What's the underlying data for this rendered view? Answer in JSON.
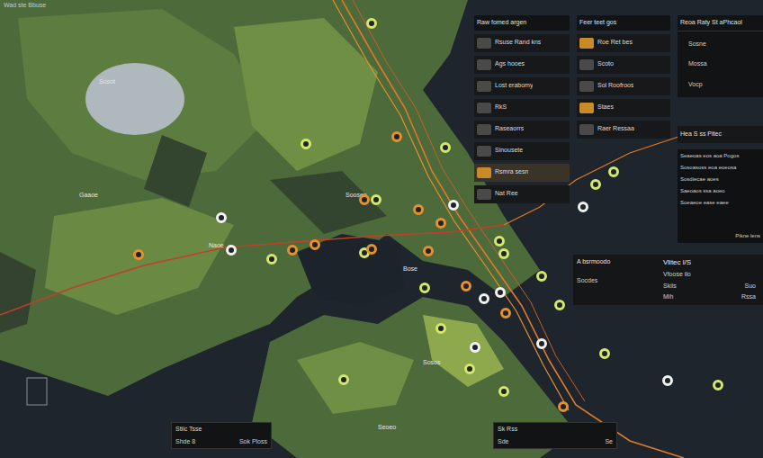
{
  "title": "Wad ste Bbuse",
  "layers": {
    "header": "Raw fomed argen",
    "rows": [
      {
        "label": "Rsuse Rand kns",
        "selected": false
      },
      {
        "label": "Ags hooes",
        "selected": false
      },
      {
        "label": "Lost erabomy",
        "selected": false
      },
      {
        "label": "RkS",
        "selected": false
      },
      {
        "label": "Raseaorrs",
        "selected": false
      },
      {
        "label": "Sinousete",
        "selected": false
      },
      {
        "label": "Rsmra sesn",
        "selected": true
      },
      {
        "label": "Nat Ree",
        "selected": false
      }
    ]
  },
  "filters": {
    "header": "Feer teet gos",
    "rows": [
      {
        "label": "Roe Ret bes",
        "selected": true
      },
      {
        "label": "Scoto",
        "selected": false
      },
      {
        "label": "Sol Roofroos",
        "selected": false
      },
      {
        "label": "Staes",
        "selected": true
      },
      {
        "label": "Raer Ressaa",
        "selected": false
      }
    ]
  },
  "details": {
    "header": "Reoa Raty St aPhcaol",
    "rows": [
      "Sosne",
      "Mossa",
      "Vocp"
    ]
  },
  "legend": {
    "header": "Hea S ss Pitec",
    "items": [
      "Seaeoas eos aoa Pogos",
      "Sosoasoss eoa eoeosa",
      "Sosdiecae aoes",
      "Saeoaos ssa aoeo",
      "Soeaeoe ease eaee"
    ],
    "footer": "Pikne lens"
  },
  "stats": {
    "title": "A bsrmoodo",
    "heading": "Vlitec l/S",
    "subheading": "Vfoose ilo",
    "label": "Socdes",
    "rows": [
      {
        "label": "Skiis",
        "value": "Suo"
      },
      {
        "label": "Mih",
        "value": "Rssa"
      }
    ]
  },
  "toolbars": [
    {
      "top": "Stiic Tsse",
      "bottom": [
        "Shde 8",
        "Sok Ploss"
      ]
    },
    {
      "top": "Sk Rss",
      "bottom": [
        "Sde",
        "Se"
      ]
    }
  ],
  "map_labels": [
    "Sosot",
    "Gaaoe",
    "Naoe",
    "Soosen",
    "Bose",
    "Sosos",
    "Seoeo"
  ],
  "pins": [
    {
      "color": "#d4e86a"
    },
    {
      "color": "#d4e86a"
    },
    {
      "color": "#e8902c"
    },
    {
      "color": "#d4e86a"
    },
    {
      "color": "#e8902c"
    },
    {
      "color": "#d4e86a"
    },
    {
      "color": "#e8902c"
    },
    {
      "color": "#e8902c"
    },
    {
      "color": "#f2f2f2"
    },
    {
      "color": "#f2f2f2"
    },
    {
      "color": "#e8902c"
    },
    {
      "color": "#f2f2f2"
    },
    {
      "color": "#d4e86a"
    },
    {
      "color": "#e8902c"
    },
    {
      "color": "#e8902c"
    },
    {
      "color": "#d4e86a"
    },
    {
      "color": "#e8902c"
    },
    {
      "color": "#e8902c"
    },
    {
      "color": "#d4e86a"
    },
    {
      "color": "#d4e86a"
    },
    {
      "color": "#d4e86a"
    },
    {
      "color": "#e8902c"
    },
    {
      "color": "#f2f2f2"
    },
    {
      "color": "#f2f2f2"
    },
    {
      "color": "#e8902c"
    },
    {
      "color": "#d4e86a"
    },
    {
      "color": "#d4e86a"
    },
    {
      "color": "#d4e86a"
    },
    {
      "color": "#f2f2f2"
    },
    {
      "color": "#d4e86a"
    },
    {
      "color": "#d4e86a"
    },
    {
      "color": "#f2f2f2"
    },
    {
      "color": "#d4e86a"
    },
    {
      "color": "#e8902c"
    },
    {
      "color": "#f2f2f2"
    },
    {
      "color": "#d4e86a"
    },
    {
      "color": "#d4e86a"
    },
    {
      "color": "#d4e86a"
    },
    {
      "color": "#d4e86a"
    },
    {
      "color": "#f2f2f2"
    }
  ]
}
